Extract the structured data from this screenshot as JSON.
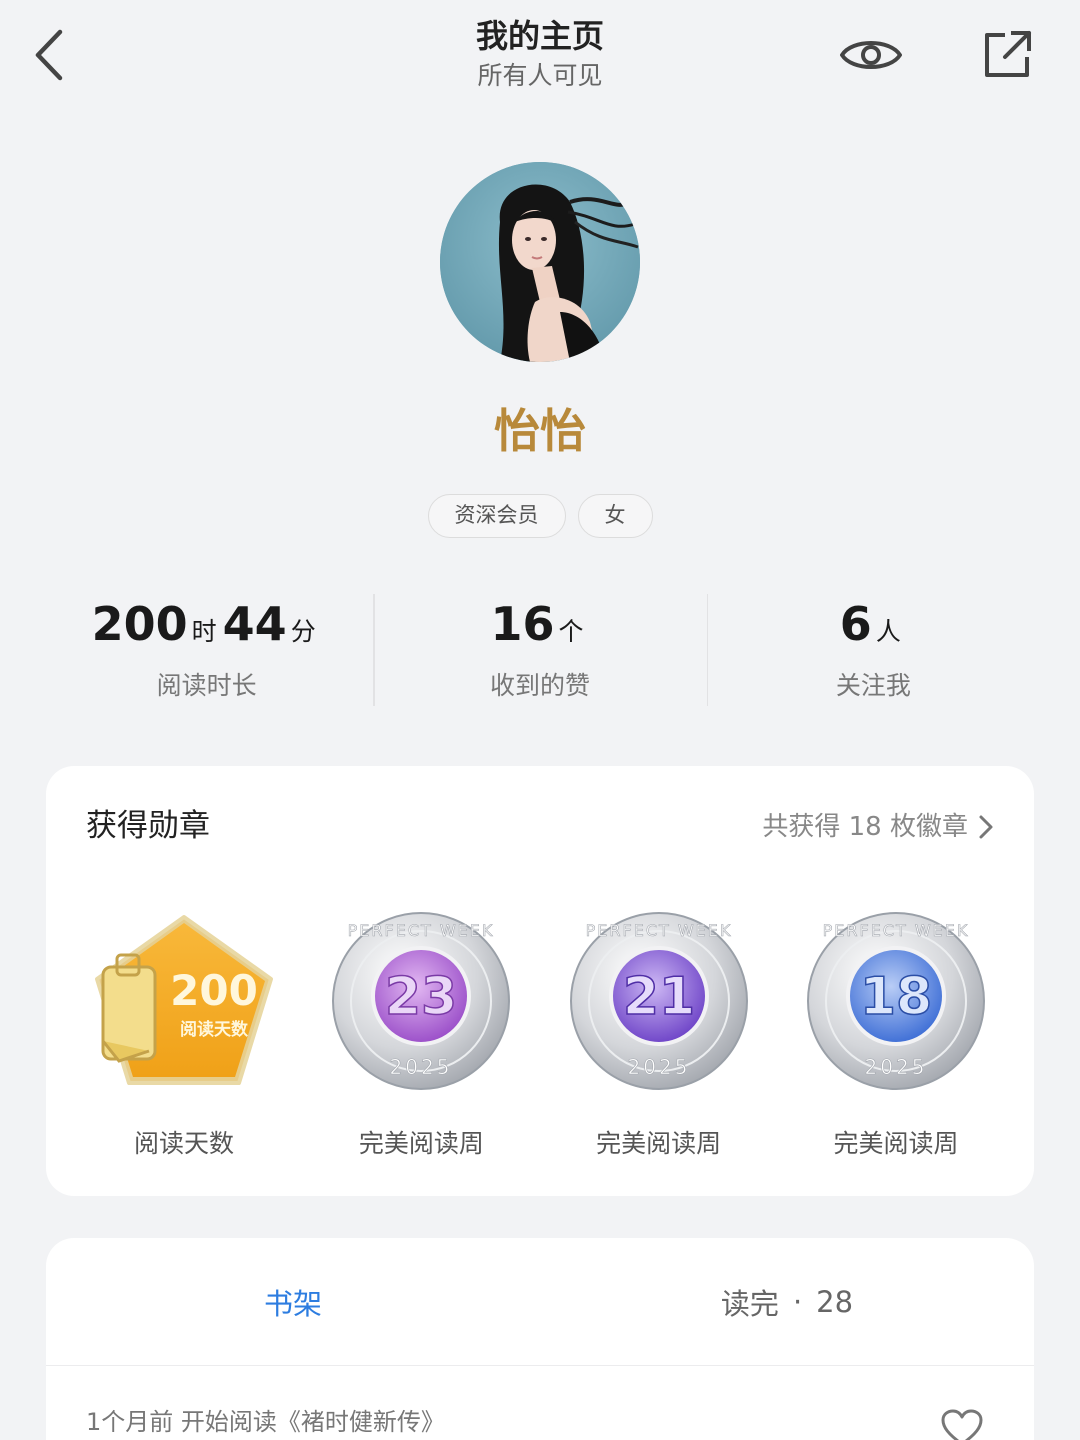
{
  "header": {
    "title": "我的主页",
    "subtitle": "所有人可见",
    "back_icon": "chevron-left-icon",
    "visibility_icon": "eye-icon",
    "share_icon": "external-share-icon"
  },
  "profile": {
    "username": "怡怡",
    "username_color": "#b8893a",
    "tags": [
      "资深会员",
      "女"
    ]
  },
  "stats": {
    "reading_time": {
      "hours": "200",
      "hours_unit": "时",
      "minutes": "44",
      "minutes_unit": "分",
      "label": "阅读时长"
    },
    "likes": {
      "value": "16",
      "unit": "个",
      "label": "收到的赞"
    },
    "followers": {
      "value": "6",
      "unit": "人",
      "label": "关注我"
    }
  },
  "medals": {
    "title": "获得勋章",
    "more_text": "共获得 18 枚徽章",
    "items": [
      {
        "name": "阅读天数",
        "badge_value": "200",
        "badge_caption": "阅读天数",
        "kind": "reading-days-badge"
      },
      {
        "name": "完美阅读周",
        "badge_value": "23",
        "badge_ring": "PERFECT WEEK",
        "badge_year": "2025",
        "kind": "perfect-week-coin",
        "accent": "#b066d6"
      },
      {
        "name": "完美阅读周",
        "badge_value": "21",
        "badge_ring": "PERFECT WEEK",
        "badge_year": "2025",
        "kind": "perfect-week-coin",
        "accent": "#7f5ad8"
      },
      {
        "name": "完美阅读周",
        "badge_value": "18",
        "badge_ring": "PERFECT WEEK",
        "badge_year": "2025",
        "kind": "perfect-week-coin",
        "accent": "#4f7fe0"
      }
    ]
  },
  "tabs": {
    "shelf": "书架",
    "finished_label": "读完",
    "finished_sep": "·",
    "finished_count": "28",
    "active_color": "#2d7de0"
  },
  "activity": {
    "text": "1个月前 开始阅读《褚时健新传》",
    "icon": "heart-outline-icon"
  }
}
